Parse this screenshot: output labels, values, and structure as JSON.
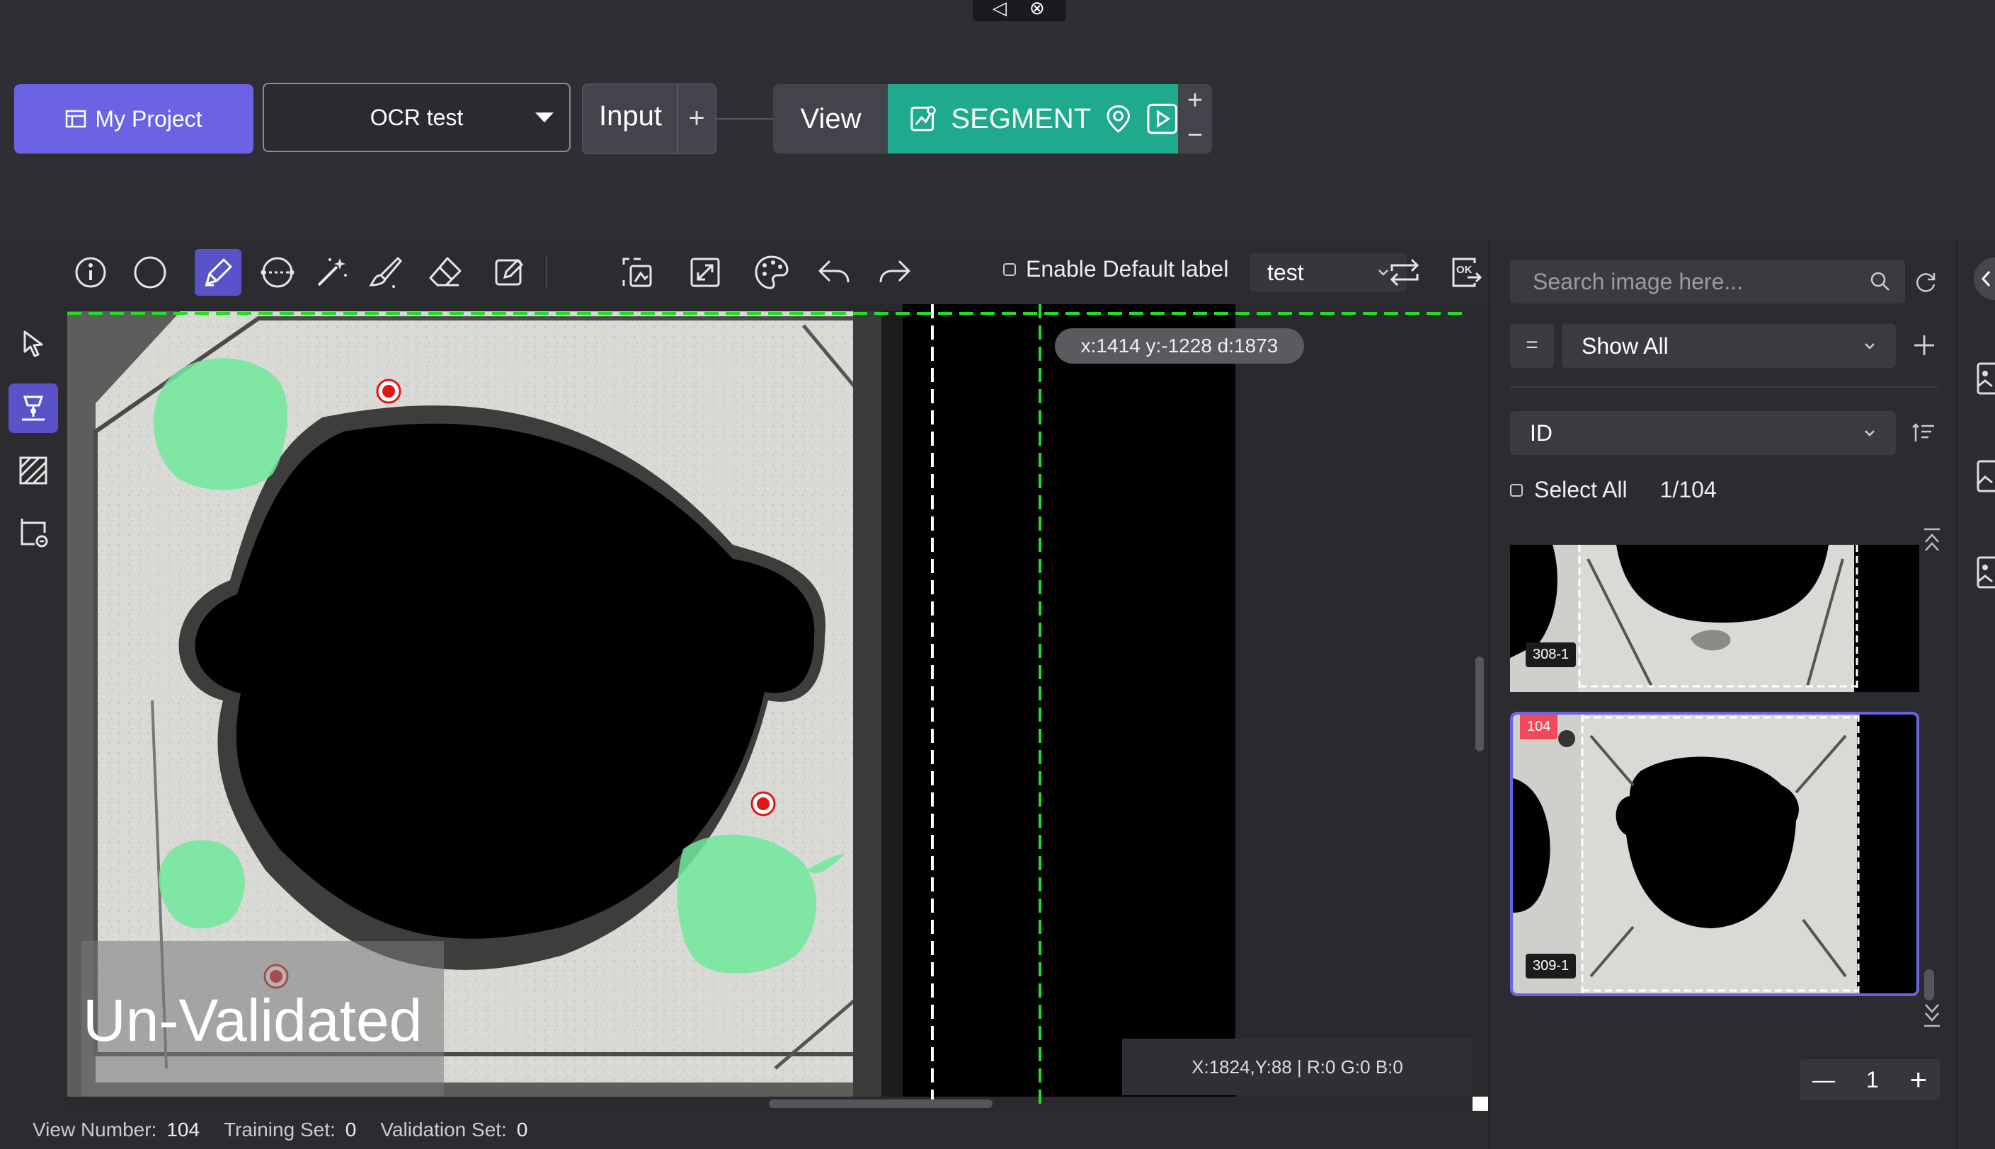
{
  "window_controls": {
    "icons": [
      "speaker-mute-icon",
      "close-icon"
    ]
  },
  "header": {
    "project_button": "My Project",
    "project_select": "OCR test",
    "nodes": {
      "input_label": "Input",
      "input_add": "+",
      "view_label": "View",
      "segment_label": "SEGMENT",
      "plus": "+",
      "minus": "−"
    }
  },
  "toolbar": {
    "enable_default_label": "Enable Default label",
    "label_value": "test",
    "tools": [
      "info-icon",
      "ellipse-icon",
      "line-icon",
      "pen-icon",
      "polygon-icon",
      "magic-wand-icon",
      "brush-icon",
      "eraser-icon",
      "edit-icon",
      "auto-label-icon",
      "fit-icon",
      "palette-icon",
      "undo-icon",
      "redo-icon",
      "swap-icon",
      "ok-export-icon"
    ]
  },
  "left_tools": [
    "pointer-icon",
    "anchor-icon",
    "hatch-icon",
    "roi-icon"
  ],
  "canvas": {
    "cursor_readout": "x:1414 y:-1228 d:1873",
    "pixel_readout": "X:1824,Y:88 | R:0 G:0 B:0",
    "status_overlay": "Un-Validated",
    "colors": {
      "mask": "#6fe89a",
      "guide": "#22dd22",
      "point": "#ff1a1a"
    }
  },
  "status_bar": {
    "view_number_label": "View Number:",
    "view_number": "104",
    "training_label": "Training Set:",
    "training": "0",
    "validation_label": "Validation Set:",
    "validation": "0"
  },
  "panel": {
    "search_placeholder": "Search image here...",
    "filter_eq": "=",
    "filter_value": "Show All",
    "sort_value": "ID",
    "select_all": "Select All",
    "count": "1/104",
    "thumbnails": [
      {
        "label": "308-1",
        "selected": false,
        "badge": ""
      },
      {
        "label": "309-1",
        "selected": true,
        "badge": "104"
      }
    ],
    "page": "1",
    "page_minus": "—",
    "page_plus": "+",
    "accent": "#6b63e4"
  }
}
